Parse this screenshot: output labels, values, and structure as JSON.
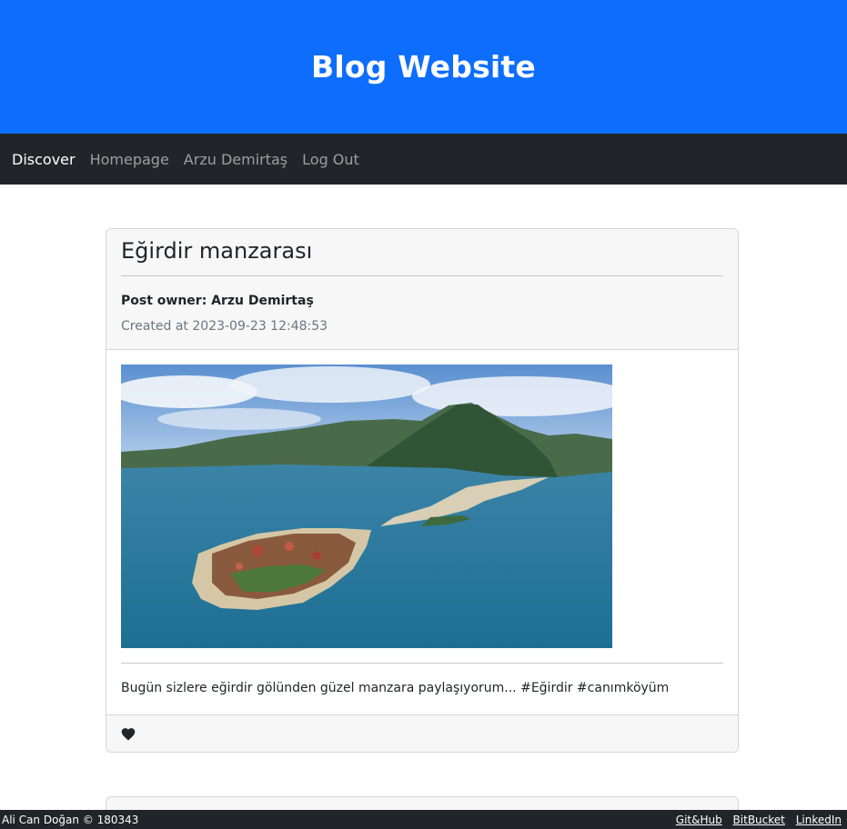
{
  "header": {
    "title": "Blog Website"
  },
  "nav": {
    "items": [
      {
        "label": "Discover",
        "active": true
      },
      {
        "label": "Homepage",
        "active": false
      },
      {
        "label": "Arzu Demirtaş",
        "active": false
      },
      {
        "label": "Log Out",
        "active": false
      }
    ]
  },
  "post": {
    "title": "Eğirdir manzarası",
    "owner": "Post owner: Arzu Demirtaş",
    "created": "Created at 2023-09-23 12:48:53",
    "text": "Bugün sizlere eğirdir gölünden güzel manzara paylaşıyorum... #Eğirdir #canımköyüm",
    "like_icon": "heart-icon"
  },
  "footer": {
    "copyright": "Ali Can Doğan © 180343",
    "links": [
      "Git&Hub",
      "BitBucket",
      "LinkedIn"
    ]
  },
  "colors": {
    "brand": "#0d6efd",
    "navbar": "#212529",
    "card_header": "#f7f7f7"
  }
}
